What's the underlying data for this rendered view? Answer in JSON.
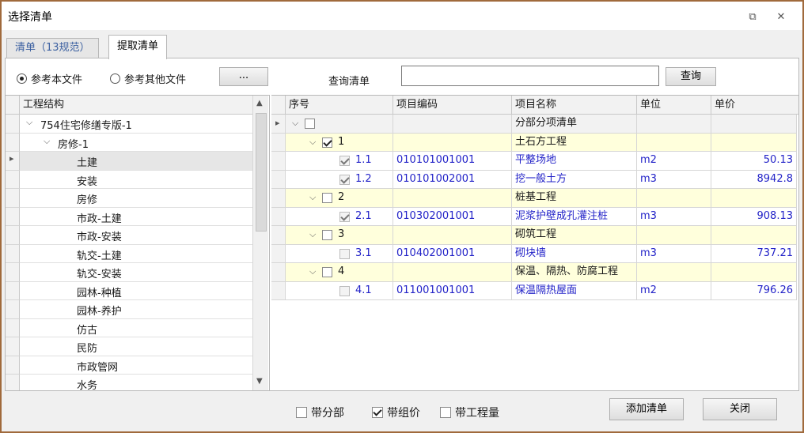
{
  "window": {
    "title": "选择清单",
    "restore_glyph": "⧉",
    "close_glyph": "✕"
  },
  "tabs": [
    {
      "label": "清单（13规范）"
    },
    {
      "label": "提取清单"
    }
  ],
  "options": {
    "radio_this_file": "参考本文件",
    "radio_other_file": "参考其他文件",
    "browse_label": "...",
    "query_label": "查询清单",
    "query_value": "",
    "query_button": "查询"
  },
  "left_tree": {
    "header": "工程结构",
    "items": [
      {
        "label": "754住宅修缮专版-1",
        "level": 0,
        "expanded": true
      },
      {
        "label": "房修-1",
        "level": 1,
        "expanded": true
      },
      {
        "label": "土建",
        "level": 2,
        "selected": true
      },
      {
        "label": "安装",
        "level": 2
      },
      {
        "label": "房修",
        "level": 2
      },
      {
        "label": "市政-土建",
        "level": 2
      },
      {
        "label": "市政-安装",
        "level": 2
      },
      {
        "label": "轨交-土建",
        "level": 2
      },
      {
        "label": "轨交-安装",
        "level": 2
      },
      {
        "label": "园林-种植",
        "level": 2
      },
      {
        "label": "园林-养护",
        "level": 2
      },
      {
        "label": "仿古",
        "level": 2
      },
      {
        "label": "民防",
        "level": 2
      },
      {
        "label": "市政管网",
        "level": 2
      },
      {
        "label": "水务",
        "level": 2
      }
    ]
  },
  "right_table": {
    "columns": [
      "序号",
      "项目编码",
      "项目名称",
      "单位",
      "单价"
    ],
    "rows": [
      {
        "seq": "",
        "code": "",
        "name": "分部分项清单",
        "unit": "",
        "price": "",
        "level": 0,
        "checked": false,
        "kind": "root"
      },
      {
        "seq": "1",
        "code": "",
        "name": "土石方工程",
        "unit": "",
        "price": "",
        "level": 1,
        "checked": true,
        "kind": "group"
      },
      {
        "seq": "1.1",
        "code": "010101001001",
        "name": "平整场地",
        "unit": "m2",
        "price": "50.13",
        "level": 2,
        "checked": true,
        "kind": "item"
      },
      {
        "seq": "1.2",
        "code": "010101002001",
        "name": "挖一般土方",
        "unit": "m3",
        "price": "8942.8",
        "level": 2,
        "checked": true,
        "kind": "item"
      },
      {
        "seq": "2",
        "code": "",
        "name": "桩基工程",
        "unit": "",
        "price": "",
        "level": 1,
        "checked": false,
        "kind": "group"
      },
      {
        "seq": "2.1",
        "code": "010302001001",
        "name": "泥浆护壁成孔灌注桩",
        "unit": "m3",
        "price": "908.13",
        "level": 2,
        "checked": true,
        "kind": "item"
      },
      {
        "seq": "3",
        "code": "",
        "name": "砌筑工程",
        "unit": "",
        "price": "",
        "level": 1,
        "checked": false,
        "kind": "group"
      },
      {
        "seq": "3.1",
        "code": "010402001001",
        "name": "砌块墙",
        "unit": "m3",
        "price": "737.21",
        "level": 2,
        "checked": false,
        "kind": "item"
      },
      {
        "seq": "4",
        "code": "",
        "name": "保温、隔热、防腐工程",
        "unit": "",
        "price": "",
        "level": 1,
        "checked": false,
        "kind": "group"
      },
      {
        "seq": "4.1",
        "code": "011001001001",
        "name": "保温隔热屋面",
        "unit": "m2",
        "price": "796.26",
        "level": 2,
        "checked": false,
        "kind": "item"
      }
    ]
  },
  "bottom": {
    "with_division": "带分部",
    "with_division_checked": false,
    "with_price": "带组价",
    "with_price_checked": true,
    "with_quantity": "带工程量",
    "with_quantity_checked": false,
    "add_button": "添加清单",
    "close_button": "关闭"
  },
  "colors": {
    "accent_border": "#a06a3c",
    "group_row_bg": "#ffffdc",
    "link_text": "#2323c8"
  }
}
